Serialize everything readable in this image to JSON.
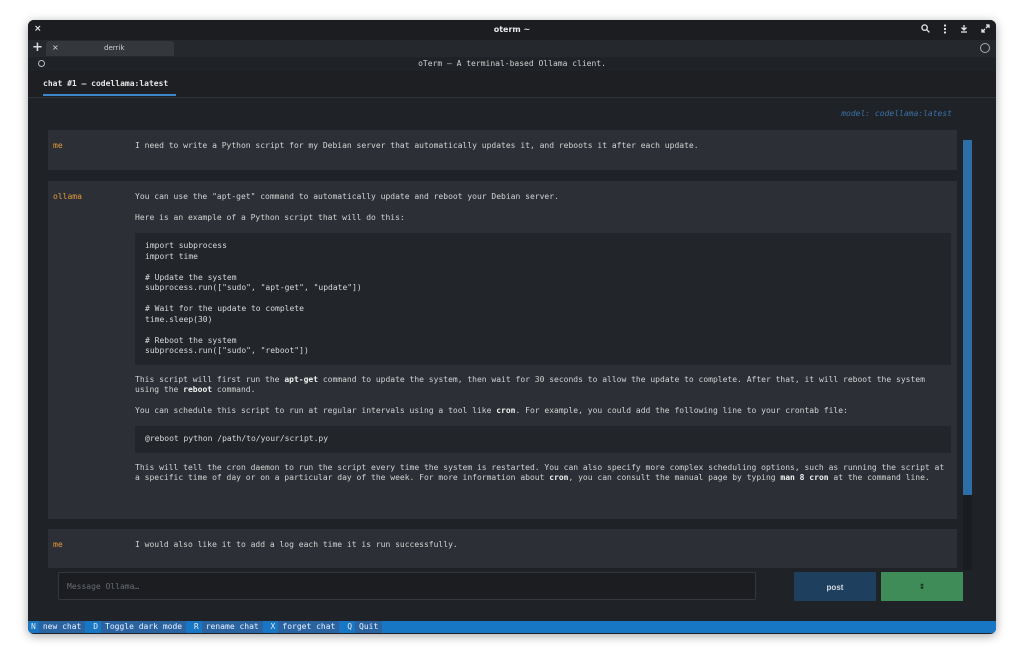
{
  "window": {
    "title": "oterm ~",
    "close_glyph": "×",
    "controls": [
      "search-icon",
      "kebab-menu-icon",
      "minimize-icon",
      "maximize-icon"
    ]
  },
  "tabs": {
    "new_glyph": "+",
    "items": [
      {
        "label": "derrik",
        "close_glyph": "×"
      }
    ]
  },
  "app": {
    "title": "oTerm – A terminal-based Ollama client."
  },
  "chat_tabs": [
    {
      "label": "chat #1 – codellama:latest",
      "active": true
    }
  ],
  "chat": {
    "model_label": "model: codellama:latest",
    "messages": [
      {
        "author": "me",
        "text": "I need to write a Python script for my Debian server that automatically updates it, and reboots it after each update."
      },
      {
        "author": "ollama",
        "p1": "You can use the \"apt-get\" command to automatically update and reboot your Debian server.",
        "p2": "Here is an example of a Python script that will do this:",
        "code1": "import subprocess\nimport time\n\n# Update the system\nsubprocess.run([\"sudo\", \"apt-get\", \"update\"])\n\n# Wait for the update to complete\ntime.sleep(30)\n\n# Reboot the system\nsubprocess.run([\"sudo\", \"reboot\"])",
        "p3_a": "This script will first run the ",
        "p3_b": "apt-get",
        "p3_c": " command to update the system, then wait for 30 seconds to allow the update to complete. After that, it will reboot the system using the ",
        "p3_d": "reboot",
        "p3_e": " command.",
        "p4_a": "You can schedule this script to run at regular intervals using a tool like ",
        "p4_b": "cron",
        "p4_c": ". For example, you could add the following line to your crontab file:",
        "code2": "@reboot python /path/to/your/script.py",
        "p5_a": "This will tell the cron daemon to run the script every time the system is restarted. You can also specify more complex scheduling options, such as running the script at a specific time of day or on a particular day of the week. For more information about ",
        "p5_b": "cron",
        "p5_c": ", you can consult the manual page by typing ",
        "p5_d": "man 8 cron",
        "p5_e": " at the command line."
      },
      {
        "author": "me",
        "text": "I would also like it to add a log each time it is run successfully."
      }
    ]
  },
  "composer": {
    "placeholder": "Message Ollama…",
    "post_label": "post",
    "stepper_glyph": "↕"
  },
  "footer": {
    "bindings": [
      {
        "key": "N",
        "label": "new chat"
      },
      {
        "key": "D",
        "label": "Toggle dark mode"
      },
      {
        "key": "R",
        "label": "rename chat"
      },
      {
        "key": "X",
        "label": "forget chat"
      },
      {
        "key": "Q",
        "label": "Quit"
      }
    ]
  },
  "colors": {
    "accent_blue": "#1877c4",
    "author_orange": "#e29a3b",
    "post_button": "#1e3f5e",
    "stepper_green": "#3f8c58"
  }
}
